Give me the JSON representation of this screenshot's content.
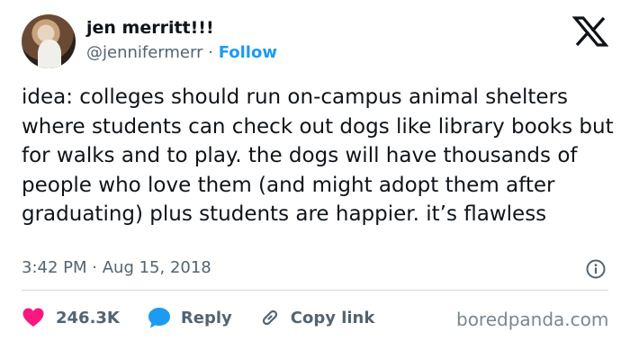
{
  "author": {
    "display_name": "jen merritt!!!",
    "handle": "@jennifermerr",
    "separator": "·",
    "follow_label": "Follow"
  },
  "platform_icon": "x-logo-icon",
  "tweet": {
    "text": "idea: colleges should run on-campus animal shelters where students can check out dogs like library books but for walks and to play. the dogs will have thousands of people who love them (and might adopt them after graduating) plus students are happier. it’s flawless",
    "time": "3:42 PM",
    "separator": "·",
    "date": "Aug 15, 2018"
  },
  "actions": {
    "likes": "246.3K",
    "reply_label": "Reply",
    "copy_link_label": "Copy link"
  },
  "icons": {
    "like": "heart-icon",
    "reply": "reply-bubble-icon",
    "copy_link": "link-icon",
    "info": "info-icon"
  },
  "colors": {
    "like": "#f91880",
    "reply": "#1d9bf0",
    "follow": "#1d9bf0",
    "muted": "#536471",
    "text": "#0f1419"
  },
  "watermark": "boredpanda.com"
}
